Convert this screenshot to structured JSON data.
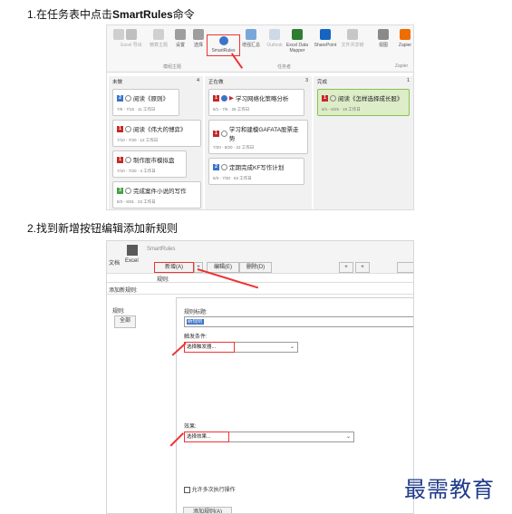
{
  "instructions": {
    "step1": "1.在任务表中点击",
    "step1_bold": "SmartRules",
    "step1_tail": "命令",
    "step2": "2.找到新增按钮编辑添加新规则"
  },
  "ribbon": {
    "buttons": [
      "Excel 导出",
      "精算主题",
      "设置",
      "选择",
      "SmartRules",
      "增强汇总",
      "Outlook",
      "Excel Data Mapper",
      "SharePoint",
      "文件共享链",
      "视图",
      "Zapier"
    ],
    "groups": [
      "模组主题",
      "任务者",
      "Zapier"
    ],
    "highlight_color": "#e53935"
  },
  "board": {
    "columns": [
      {
        "name": "未做",
        "count": "4"
      },
      {
        "name": "正在做",
        "count": "3"
      },
      {
        "name": "完成",
        "count": "1"
      }
    ],
    "cards_todo": [
      {
        "title": "阅读《原则》",
        "meta": "7/6 - 7/15 · 11 工作日"
      },
      {
        "title": "阅读《伟大的博弈》",
        "meta": "7/10 - 7/20 · 12 工作日"
      },
      {
        "title": "制作股市模拟盘",
        "meta": "7/10 - 7/20 · 4 工作日"
      },
      {
        "title": "完成案件小说的写作",
        "meta": "8/3 - 8/31 · 23 工作日"
      }
    ],
    "cards_doing": [
      {
        "title": "学习网络化策略分析",
        "meta": "6/1 - 7/6 · 26 工作日"
      },
      {
        "title": "学习和建模GAFATA股票走势",
        "meta": "7/20 - 8/20 · 22 工作日"
      },
      {
        "title": "定期完成KF写作计划",
        "meta": "5/3 - 7/30 · 63 工作日"
      }
    ],
    "cards_done": [
      {
        "title": "阅读《怎样选择成长股》",
        "meta": "6/1 - 6/25 · 19 工作日"
      }
    ]
  },
  "dialog": {
    "title": "SmartRules",
    "sidebar_top": "文档",
    "sidebar_sub": "Excel",
    "new_btn": "新增(A)",
    "edit_btn": "编辑(E)",
    "delete_btn": "删除(D)",
    "plus": "+",
    "rule_label": "规则:",
    "add_rule": "添加新规则:",
    "rule_list_label": "规则:",
    "all_btn": "全部",
    "name_label": "规则标题:",
    "name_value": "新规则",
    "trigger_label": "触发条件:",
    "trigger_value": "选择触发器...",
    "action_label": "效果:",
    "action_value": "选择效果...",
    "checkbox_label": "允许多次执行操作",
    "add_button": "添加规则(A)"
  },
  "watermark": "最需教育"
}
